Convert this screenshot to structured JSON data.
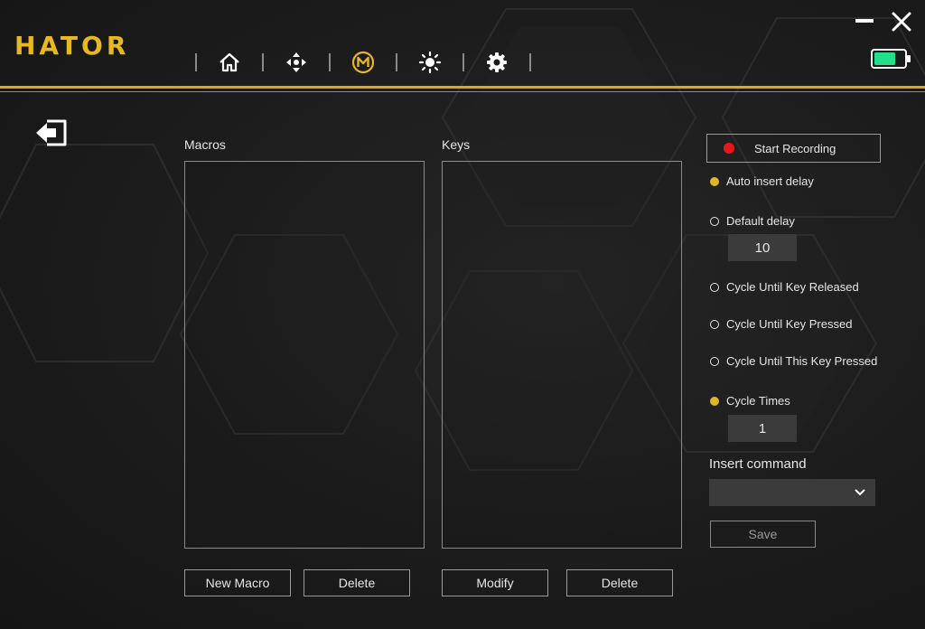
{
  "app": {
    "logo": "HATOR"
  },
  "nav": {
    "items": [
      "home-icon",
      "dpad-icon",
      "macro-icon",
      "brightness-icon",
      "gear-icon"
    ],
    "active": "macro-icon",
    "accent": "#e8b821"
  },
  "window": {
    "minimize_icon": "minimize-icon",
    "close_icon": "close-icon",
    "battery_color": "#22e08a"
  },
  "macros": {
    "label": "Macros",
    "new_label": "New Macro",
    "delete_label": "Delete"
  },
  "keys": {
    "label": "Keys",
    "modify_label": "Modify",
    "delete_label": "Delete"
  },
  "recording": {
    "start_label": "Start Recording",
    "dot_color": "#e81818"
  },
  "delay": {
    "auto_label": "Auto insert delay",
    "default_label": "Default delay",
    "default_value": "10",
    "selected": "auto"
  },
  "cycle": {
    "until_released_label": "Cycle Until Key Released",
    "until_pressed_label": "Cycle Until Key Pressed",
    "until_this_pressed_label": "Cycle Until This Key Pressed",
    "times_label": "Cycle Times",
    "times_value": "1",
    "selected": "times"
  },
  "insert": {
    "label": "Insert command",
    "value": ""
  },
  "save_label": "Save"
}
